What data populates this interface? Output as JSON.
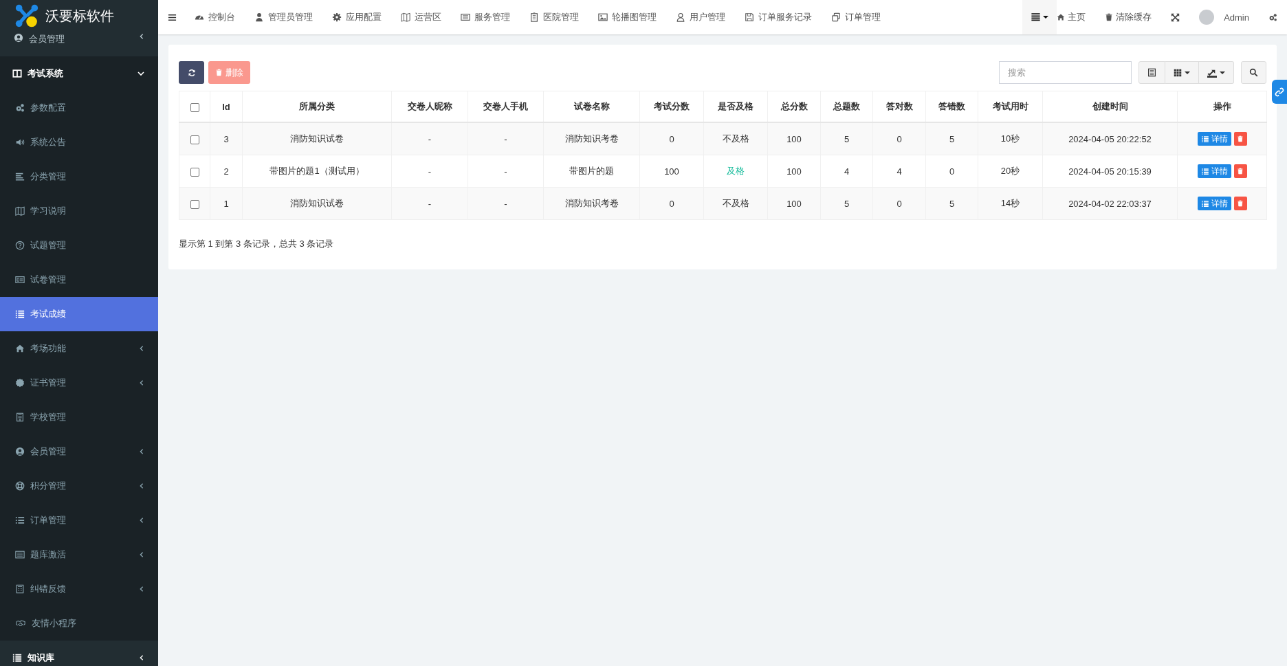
{
  "brand": {
    "name": "沃要标软件"
  },
  "sidebar": {
    "items": [
      {
        "label": "会员管理",
        "expanded": false
      },
      {
        "label": "考试系统",
        "expanded": true,
        "children": [
          {
            "label": "参数配置",
            "kind": "link",
            "selected": false
          },
          {
            "label": "系统公告",
            "kind": "link",
            "selected": false
          },
          {
            "label": "分类管理",
            "kind": "link",
            "selected": false
          },
          {
            "label": "学习说明",
            "kind": "link",
            "selected": false
          },
          {
            "label": "试题管理",
            "kind": "link",
            "selected": false
          },
          {
            "label": "试卷管理",
            "kind": "link",
            "selected": false
          },
          {
            "label": "考试成绩",
            "kind": "link",
            "selected": true
          },
          {
            "label": "考场功能",
            "kind": "group",
            "selected": false
          },
          {
            "label": "证书管理",
            "kind": "group",
            "selected": false
          },
          {
            "label": "学校管理",
            "kind": "link",
            "selected": false
          },
          {
            "label": "会员管理",
            "kind": "group",
            "selected": false
          },
          {
            "label": "积分管理",
            "kind": "group",
            "selected": false
          },
          {
            "label": "订单管理",
            "kind": "group",
            "selected": false
          },
          {
            "label": "题库激活",
            "kind": "group",
            "selected": false
          },
          {
            "label": "纠错反馈",
            "kind": "group",
            "selected": false
          },
          {
            "label": "友情小程序",
            "kind": "link",
            "selected": false
          }
        ]
      },
      {
        "label": "知识库",
        "expanded": false
      }
    ]
  },
  "topbar": {
    "nav": [
      {
        "label": "控制台"
      },
      {
        "label": "管理员管理"
      },
      {
        "label": "应用配置"
      },
      {
        "label": "运营区"
      },
      {
        "label": "服务管理"
      },
      {
        "label": "医院管理"
      },
      {
        "label": "轮播图管理"
      },
      {
        "label": "用户管理"
      },
      {
        "label": "订单服务记录"
      },
      {
        "label": "订单管理"
      }
    ],
    "home": "主页",
    "clear_cache": "清除缓存",
    "user": "Admin"
  },
  "toolbar": {
    "delete": {
      "label": "删除",
      "disabled": true
    },
    "search": {
      "placeholder": "搜索"
    }
  },
  "table": {
    "columns": [
      "Id",
      "所属分类",
      "交卷人昵称",
      "交卷人手机",
      "试卷名称",
      "考试分数",
      "是否及格",
      "总分数",
      "总题数",
      "答对数",
      "答错数",
      "考试用时",
      "创建时间",
      "操作"
    ],
    "header_checked": false,
    "rows": [
      {
        "checked": false,
        "passed": false,
        "cells": [
          "3",
          "消防知识试卷",
          "-",
          "-",
          "消防知识考卷",
          "0",
          "不及格",
          "100",
          "5",
          "0",
          "5",
          "10秒",
          "2024-04-05 20:22:52"
        ],
        "detail": "详情"
      },
      {
        "checked": false,
        "passed": true,
        "cells": [
          "2",
          "带图片的题1（测试用）",
          "-",
          "-",
          "带图片的题",
          "100",
          "及格",
          "100",
          "4",
          "4",
          "0",
          "20秒",
          "2024-04-05 20:15:39"
        ],
        "detail": "详情"
      },
      {
        "checked": false,
        "passed": false,
        "cells": [
          "1",
          "消防知识试卷",
          "-",
          "-",
          "消防知识考卷",
          "0",
          "不及格",
          "100",
          "5",
          "0",
          "5",
          "14秒",
          "2024-04-02 22:03:37"
        ],
        "detail": "详情"
      }
    ]
  },
  "pagination": {
    "summary": "显示第 1 到第 3 条记录，总共 3 条记录"
  }
}
